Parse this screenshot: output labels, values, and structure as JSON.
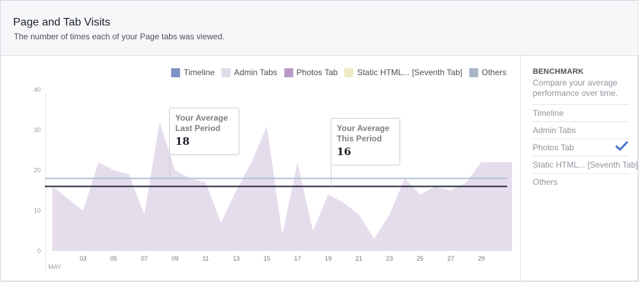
{
  "header": {
    "title": "Page and Tab Visits",
    "subtitle": "The number of times each of your Page tabs was viewed."
  },
  "legend": [
    {
      "label": "Timeline",
      "color": "#7f93c4"
    },
    {
      "label": "Admin Tabs",
      "color": "#dadde8"
    },
    {
      "label": "Photos Tab",
      "color": "#b99ac9"
    },
    {
      "label": "Static HTML... [Seventh Tab]",
      "color": "#f0ebc4"
    },
    {
      "label": "Others",
      "color": "#a9b6c8"
    }
  ],
  "callouts": {
    "last": {
      "line1": "Your Average",
      "line2": "Last Period",
      "value": "18"
    },
    "this": {
      "line1": "Your Average",
      "line2": "This Period",
      "value": "16"
    }
  },
  "sidebar": {
    "title": "BENCHMARK",
    "description": "Compare your average performance over time.",
    "items": [
      {
        "label": "Timeline",
        "checked": false
      },
      {
        "label": "Admin Tabs",
        "checked": false
      },
      {
        "label": "Photos Tab",
        "checked": true
      },
      {
        "label": "Static HTML... [Seventh Tab]",
        "checked": false
      },
      {
        "label": "Others",
        "checked": false
      }
    ]
  },
  "chart_data": {
    "type": "area",
    "x_label_month": "MAY",
    "x_tick_labels": [
      "03",
      "05",
      "07",
      "09",
      "11",
      "13",
      "15",
      "17",
      "19",
      "21",
      "23",
      "25",
      "27",
      "29"
    ],
    "x_tick_days": [
      3,
      5,
      7,
      9,
      11,
      13,
      15,
      17,
      19,
      21,
      23,
      25,
      27,
      29
    ],
    "ylim": [
      0,
      40
    ],
    "y_ticks": [
      0,
      10,
      20,
      30,
      40
    ],
    "series": [
      {
        "name": "Photos Tab",
        "color": "#e5ddec",
        "x": [
          1,
          2,
          3,
          4,
          5,
          6,
          7,
          8,
          9,
          10,
          11,
          12,
          13,
          14,
          15,
          16,
          17,
          18,
          19,
          20,
          21,
          22,
          23,
          24,
          25,
          26,
          27,
          28,
          29,
          30,
          31
        ],
        "values": [
          16,
          13,
          10,
          22,
          20,
          19,
          9,
          32,
          20,
          18,
          17,
          7,
          15,
          22,
          31,
          4,
          22,
          5,
          14,
          12,
          9,
          3,
          9,
          18,
          14,
          16,
          15,
          17,
          22,
          22,
          22
        ]
      }
    ],
    "averages": [
      {
        "name": "Your Average Last Period",
        "value": 18,
        "color": "#b3c0d8"
      },
      {
        "name": "Your Average This Period",
        "value": 16,
        "color": "#23293b"
      }
    ]
  }
}
